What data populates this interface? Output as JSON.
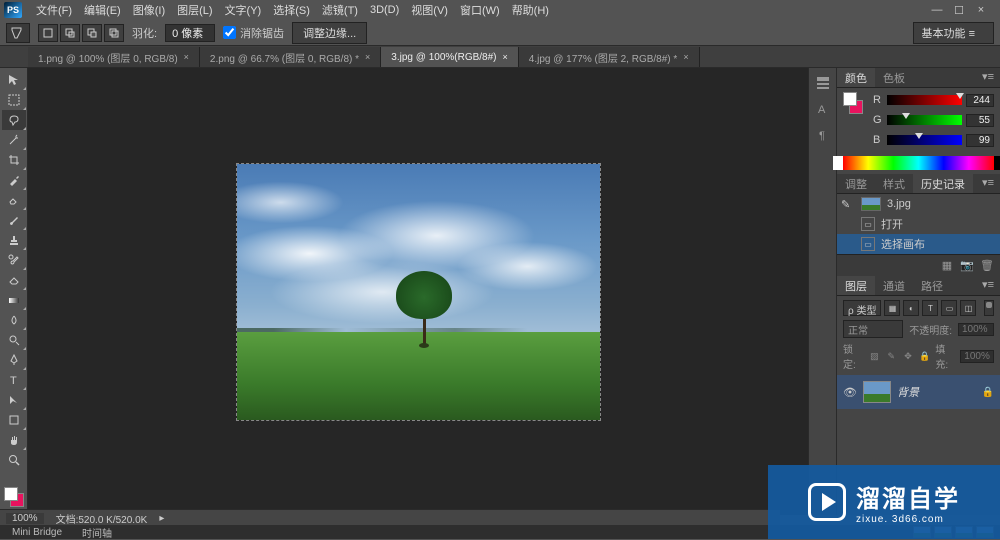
{
  "titlebar": {
    "logo": "PS"
  },
  "menus": [
    "文件(F)",
    "编辑(E)",
    "图像(I)",
    "图层(L)",
    "文字(Y)",
    "选择(S)",
    "滤镜(T)",
    "3D(D)",
    "视图(V)",
    "窗口(W)",
    "帮助(H)"
  ],
  "options": {
    "feather_label": "羽化:",
    "feather_value": "0 像素",
    "antialias_label": "消除锯齿",
    "refine_edge": "调整边缘...",
    "workspace": "基本功能"
  },
  "tabs": [
    {
      "label": "1.png @ 100% (图层 0, RGB/8)",
      "active": false
    },
    {
      "label": "2.png @ 66.7% (图层 0, RGB/8) *",
      "active": false
    },
    {
      "label": "3.jpg @ 100%(RGB/8#)",
      "active": true
    },
    {
      "label": "4.jpg @ 177% (图层 2, RGB/8#) *",
      "active": false
    }
  ],
  "color_panel": {
    "tabs": [
      "颜色",
      "色板"
    ],
    "r_label": "R",
    "r_value": "244",
    "g_label": "G",
    "g_value": "55",
    "b_label": "B",
    "b_value": "99"
  },
  "history_panel": {
    "tabs": [
      "调整",
      "样式",
      "历史记录"
    ],
    "doc": "3.jpg",
    "items": [
      "打开",
      "选择画布"
    ]
  },
  "layers_panel": {
    "tabs": [
      "图层",
      "通道",
      "路径"
    ],
    "filter_kind": "ρ 类型",
    "blend_mode": "正常",
    "opacity_label": "不透明度:",
    "opacity_value": "100%",
    "lock_label": "锁定:",
    "fill_label": "填充:",
    "fill_value": "100%",
    "layer_name": "背景"
  },
  "status": {
    "zoom": "100%",
    "doc_label": "文档:520.0 K/520.0K"
  },
  "bottom": {
    "tabs": [
      "Mini Bridge",
      "时间轴"
    ]
  },
  "watermark": {
    "title": "溜溜自学",
    "sub": "zixue. 3d66.com"
  }
}
